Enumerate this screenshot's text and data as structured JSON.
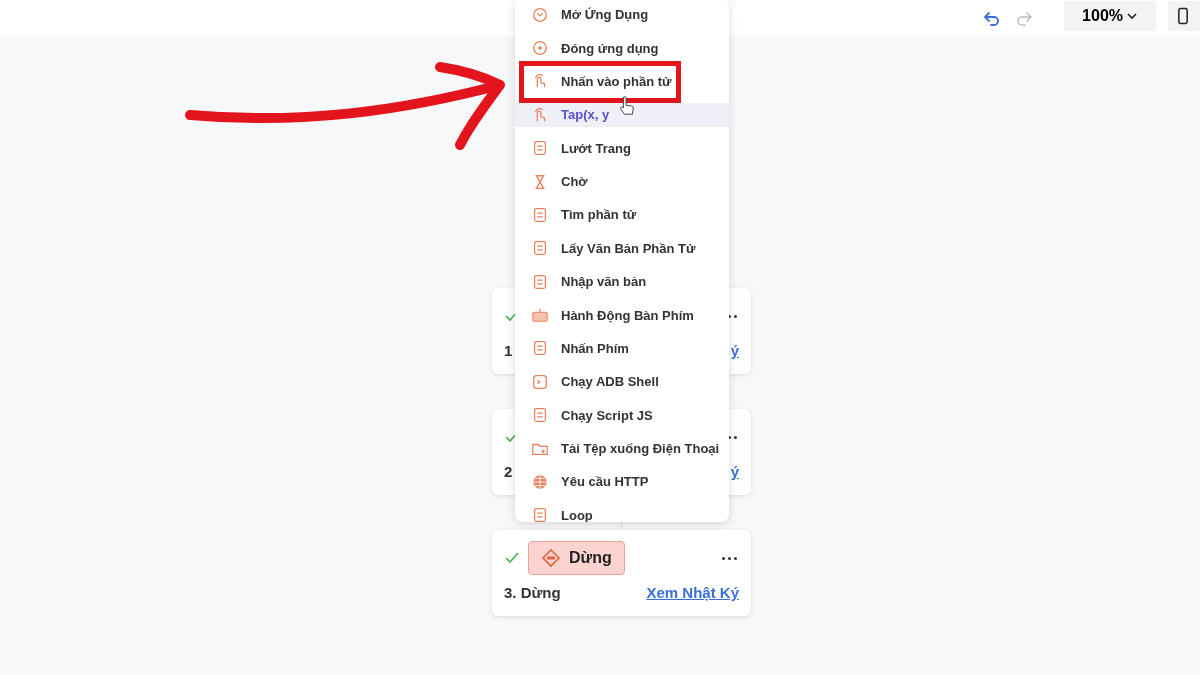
{
  "toolbar": {
    "undo_enabled": true,
    "redo_enabled": false,
    "zoom": "100%"
  },
  "menu": {
    "items": [
      {
        "label": "Mở Ứng Dụng",
        "selected": false
      },
      {
        "label": "Đóng ứng dụng",
        "selected": false
      },
      {
        "label": "Nhấn vào phần tử",
        "selected": false
      },
      {
        "label": "Tap(x, y",
        "selected": true
      },
      {
        "label": "Lướt Trang",
        "selected": false
      },
      {
        "label": "Chờ",
        "selected": false
      },
      {
        "label": "Tìm phần tử",
        "selected": false
      },
      {
        "label": "Lấy Văn Bản Phần Tử",
        "selected": false
      },
      {
        "label": "Nhập văn bản",
        "selected": false
      },
      {
        "label": "Hành Động Bàn Phím",
        "selected": false
      },
      {
        "label": "Nhấn Phím",
        "selected": false
      },
      {
        "label": "Chạy ADB Shell",
        "selected": false
      },
      {
        "label": "Chạy Script JS",
        "selected": false
      },
      {
        "label": "Tải Tệp xuống Điện Thoại",
        "selected": false
      },
      {
        "label": "Yêu cầu HTTP",
        "selected": false
      },
      {
        "label": "Loop",
        "selected": false
      }
    ]
  },
  "cards": [
    {
      "done": true,
      "title": "1",
      "link": "ý"
    },
    {
      "done": true,
      "title": "2",
      "link": "ý"
    },
    {
      "done": true,
      "badge": "Dừng",
      "title": "3. Dừng",
      "link": "Xem Nhật Ký"
    }
  ]
}
